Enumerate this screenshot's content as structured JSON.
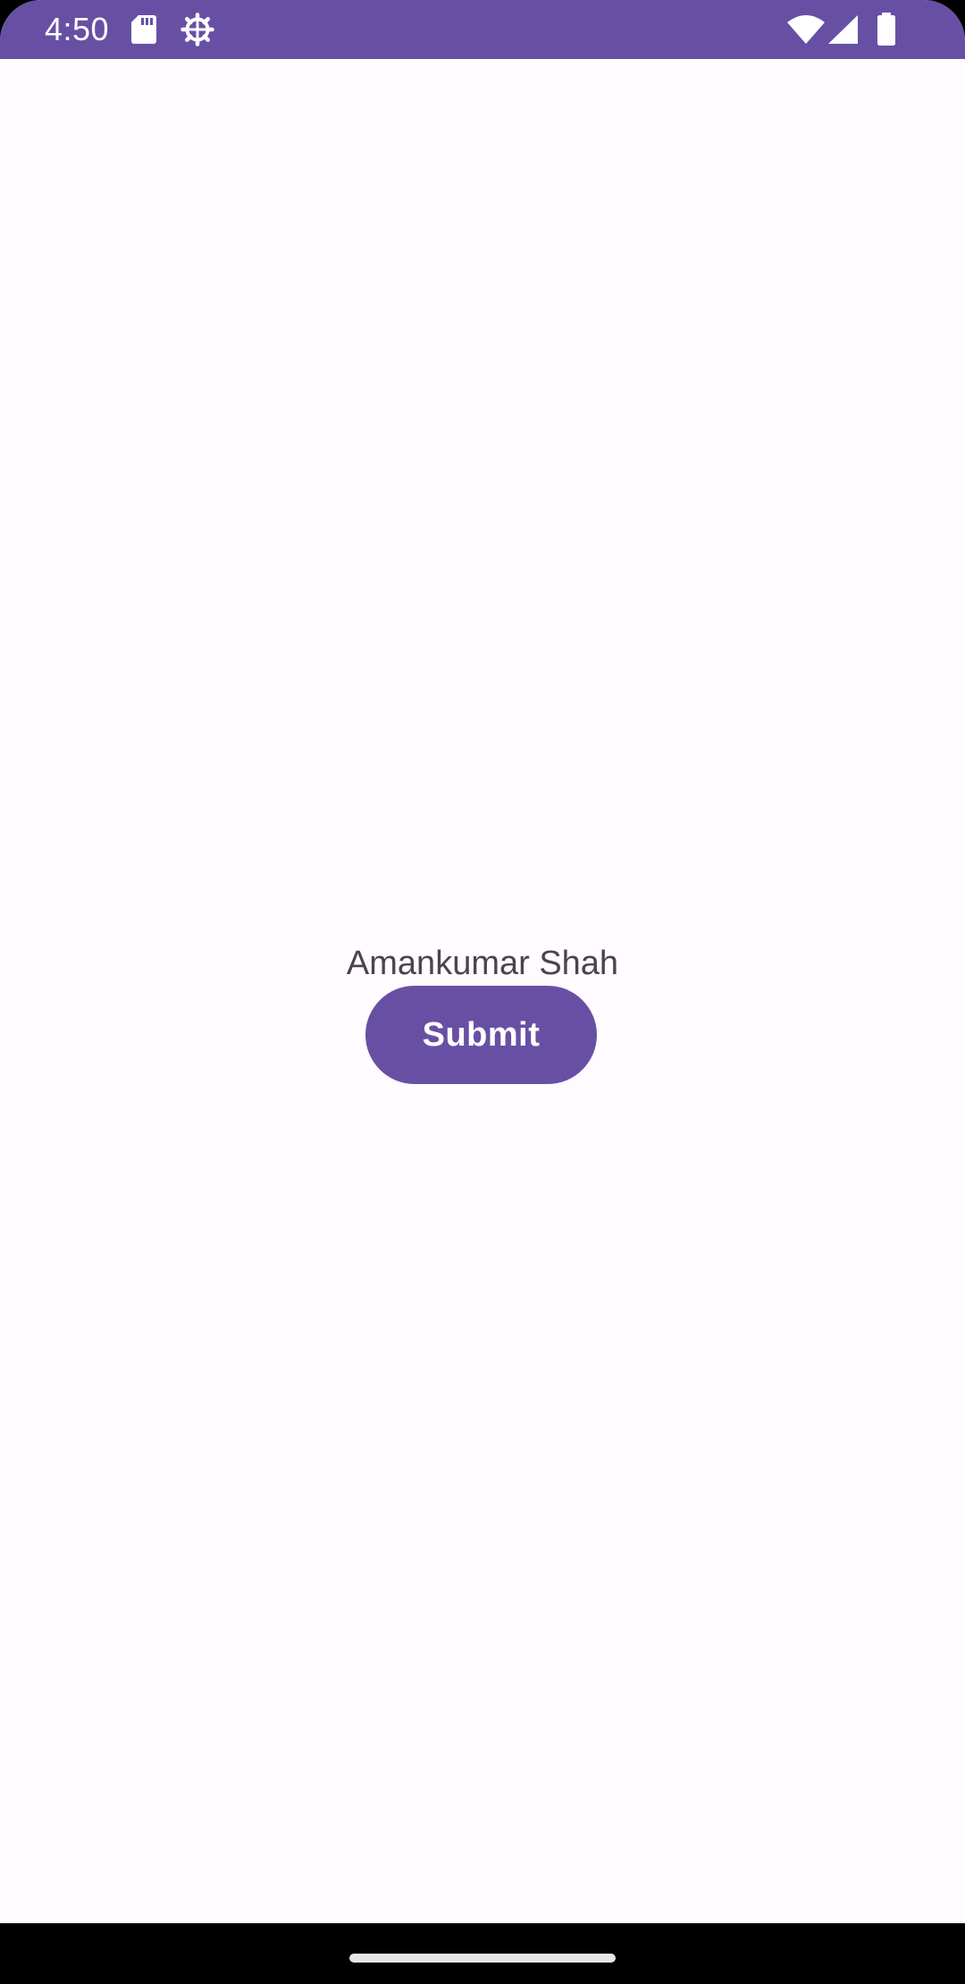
{
  "colors": {
    "status_bar": "#6750A4",
    "background": "#FFFBFE",
    "primary": "#6750A4",
    "on_primary": "#FFFFFF",
    "text": "#49454F",
    "nav_bar": "#000000"
  },
  "status_bar": {
    "time": "4:50",
    "left_icons": [
      "sd-card-icon",
      "settings-gear-icon"
    ],
    "right_icons": [
      "wifi-icon",
      "cellular-signal-icon",
      "battery-icon"
    ]
  },
  "main": {
    "name_text": "Amankumar Shah",
    "submit_label": "Submit"
  }
}
